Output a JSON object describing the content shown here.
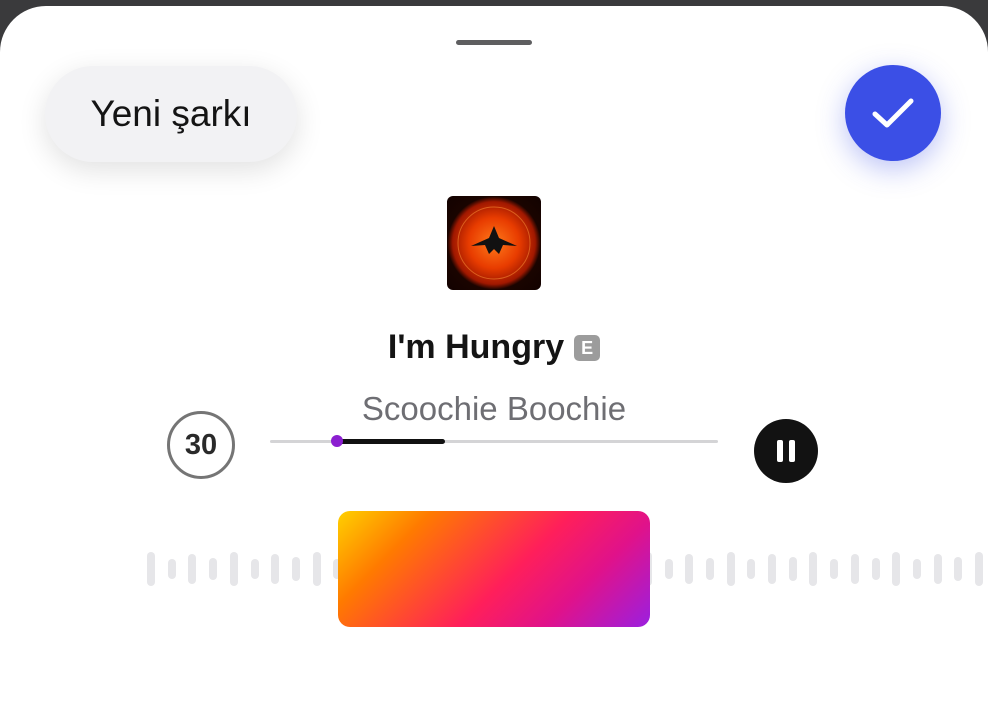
{
  "header": {
    "new_song_label": "Yeni şarkı"
  },
  "track": {
    "title": "I'm Hungry",
    "explicit_badge": "E",
    "artist": "Scoochie Boochie",
    "clip_duration": "30",
    "progress_start": 0.15,
    "progress_end": 0.39
  },
  "colors": {
    "accent": "#3b4fe6",
    "scrub_knob": "#8b1fd0"
  },
  "icons": [
    "grabber-handle",
    "checkmark-icon",
    "album-art",
    "explicit-badge",
    "pause-icon",
    "waveform"
  ]
}
